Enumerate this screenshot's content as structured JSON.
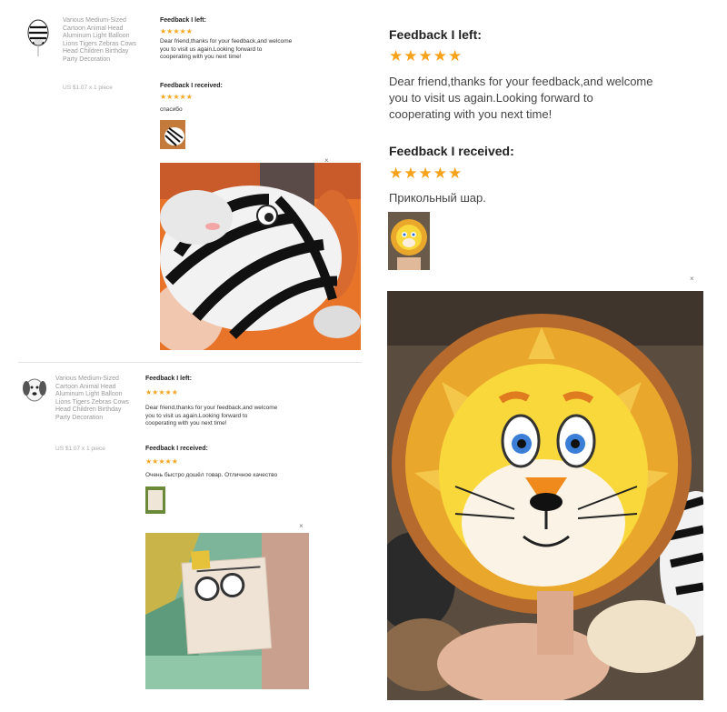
{
  "review1": {
    "product": {
      "title_lines": [
        "Various Medium-Sized",
        "Cartoon Animal Head",
        "Aluminum Light Balloon",
        "Lions Tigers Zebras Cows",
        "Head Children Birthday",
        "Party Decoration"
      ],
      "price": "US $1.07 x 1 piece",
      "thumb_icon": "zebra-balloon-icon"
    },
    "feedback_left": {
      "title": "Feedback I left:",
      "stars": "★★★★★",
      "text_lines": [
        "Dear friend,thanks for your feedback,and welcome",
        "you to visit us again.Looking forward to",
        "cooperating with you next time!"
      ]
    },
    "feedback_received": {
      "title": "Feedback I received:",
      "stars": "★★★★★",
      "text": "спасибо"
    },
    "close": "×"
  },
  "review2": {
    "product": {
      "title_lines": [
        "Various Medium-Sized",
        "Cartoon Animal Head",
        "Aluminum Light Balloon",
        "Lions Tigers Zebras Cows",
        "Head Children Birthday",
        "Party Decoration"
      ],
      "price": "US $1.07 x 1 piece",
      "thumb_icon": "dog-balloon-icon"
    },
    "feedback_left": {
      "title": "Feedback I left:",
      "stars": "★★★★★",
      "text_lines": [
        "Dear friend,thanks for your feedback,and welcome",
        "you to visit us again.Looking forward to",
        "cooperating with you next time!"
      ]
    },
    "feedback_received": {
      "title": "Feedback I received:",
      "stars": "★★★★★",
      "text": "Очень быстро дошёл товар. Отличное качество"
    },
    "close": "×"
  },
  "review3": {
    "feedback_left": {
      "title": "Feedback I left:",
      "stars": "★★★★★",
      "text_lines": [
        "Dear friend,thanks for your feedback,and welcome",
        "you to visit us again.Looking forward to",
        "cooperating with you next time!"
      ]
    },
    "feedback_received": {
      "title": "Feedback I received:",
      "stars": "★★★★★",
      "text": "Прикольный шар."
    },
    "close": "×"
  },
  "colors": {
    "star": "#f7a21b",
    "zebra_bg": "#e8742a",
    "lion_face": "#f9d83c",
    "lion_mane": "#e9a72c"
  }
}
